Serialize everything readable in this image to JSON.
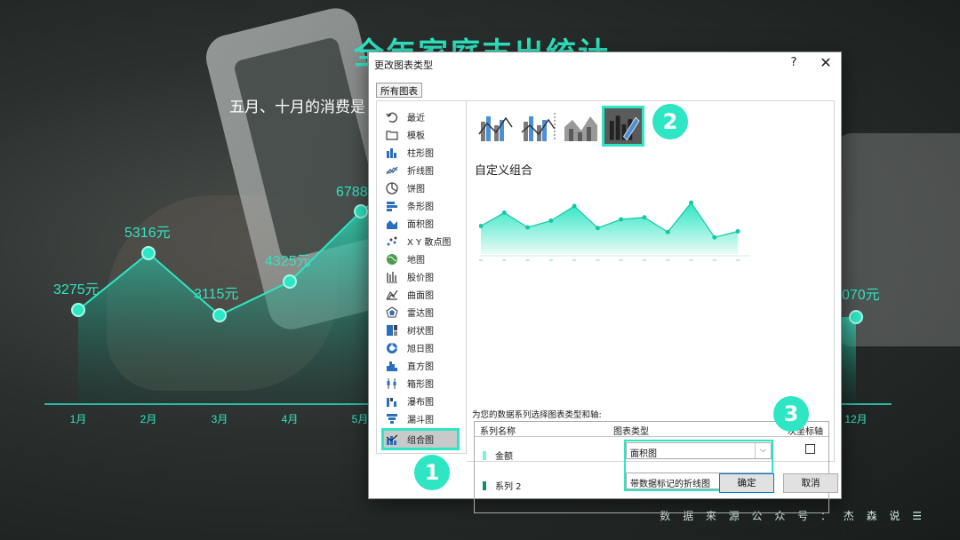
{
  "slide": {
    "title": "全年家庭支出统计",
    "subtitle": "五月、十月的消费是",
    "footer": "数 据 来 源 公 众 号 ： 杰 森 说 ☰",
    "accent": "#2ee6c3"
  },
  "background_chart": {
    "months_visible": [
      "1月",
      "2月",
      "3月",
      "4月",
      "5月",
      "12月"
    ],
    "value_labels": [
      "3275元",
      "5316元",
      "3115元",
      "4325元",
      "6788",
      "070元"
    ]
  },
  "dialog": {
    "title": "更改图表类型",
    "help": "?",
    "close": "✕",
    "tab": "所有图表",
    "chart_types": [
      {
        "label": "最近",
        "icon": "recent-icon"
      },
      {
        "label": "模板",
        "icon": "template-folder-icon"
      },
      {
        "label": "柱形图",
        "icon": "column-chart-icon"
      },
      {
        "label": "折线图",
        "icon": "line-chart-icon"
      },
      {
        "label": "饼图",
        "icon": "pie-chart-icon"
      },
      {
        "label": "条形图",
        "icon": "bar-chart-icon"
      },
      {
        "label": "面积图",
        "icon": "area-chart-icon"
      },
      {
        "label": "X Y 散点图",
        "icon": "scatter-chart-icon"
      },
      {
        "label": "地图",
        "icon": "map-chart-icon"
      },
      {
        "label": "股价图",
        "icon": "stock-chart-icon"
      },
      {
        "label": "曲面图",
        "icon": "surface-chart-icon"
      },
      {
        "label": "雷达图",
        "icon": "radar-chart-icon"
      },
      {
        "label": "树状图",
        "icon": "treemap-chart-icon"
      },
      {
        "label": "旭日图",
        "icon": "sunburst-chart-icon"
      },
      {
        "label": "直方图",
        "icon": "histogram-chart-icon"
      },
      {
        "label": "箱形图",
        "icon": "box-whisker-chart-icon"
      },
      {
        "label": "瀑布图",
        "icon": "waterfall-chart-icon"
      },
      {
        "label": "漏斗图",
        "icon": "funnel-chart-icon"
      },
      {
        "label": "组合图",
        "icon": "combo-chart-icon"
      }
    ],
    "selected_type": "组合图",
    "combo_heading": "自定义组合",
    "preview_values": [
      0.42,
      0.62,
      0.4,
      0.5,
      0.72,
      0.39,
      0.52,
      0.55,
      0.33,
      0.77,
      0.25,
      0.34
    ],
    "series_instruction": "为您的数据系列选择图表类型和轴:",
    "table_headers": {
      "name": "系列名称",
      "type": "图表类型",
      "axis": "次坐标轴"
    },
    "series": [
      {
        "name": "金额",
        "type": "面积图",
        "color": "#7ff0d9"
      },
      {
        "name": "系列 2",
        "type": "带数据标记的折线图",
        "color": "#0e8f73"
      }
    ],
    "ok": "确定",
    "cancel": "取消"
  },
  "annotations": [
    "1",
    "2",
    "3"
  ]
}
